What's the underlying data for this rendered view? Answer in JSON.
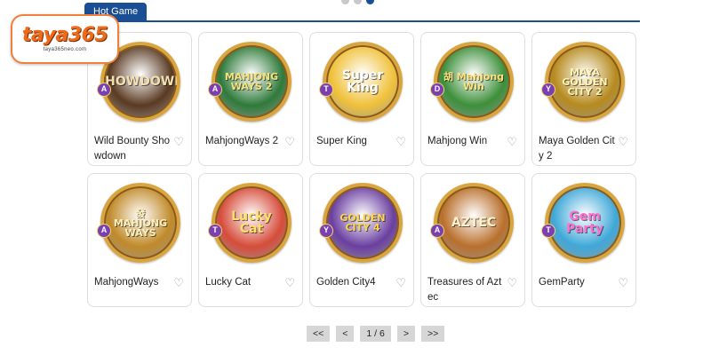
{
  "tabs": {
    "active": "Hot Game"
  },
  "logo": {
    "word": "taya365",
    "sub": "taya365neo.com"
  },
  "games": [
    {
      "name": "Wild Bounty Showdown",
      "art": "SHOWDOWN",
      "badge": "A",
      "bg": "#5a3a22",
      "fg": "#f2dfb0"
    },
    {
      "name": "MahjongWays 2",
      "art": "MAHJONG WAYS 2",
      "badge": "A",
      "bg": "#2f7a3a",
      "fg": "#f6e27a"
    },
    {
      "name": "Super King",
      "art": "Super King",
      "badge": "T",
      "bg": "#f0c13a",
      "fg": "#ffffff"
    },
    {
      "name": "Mahjong Win",
      "art": "胡 Mahjong Win",
      "badge": "D",
      "bg": "#3d8f3a",
      "fg": "#ffe17a"
    },
    {
      "name": "Maya Golden City 2",
      "art": "MAYA GOLDEN CITY 2",
      "badge": "Y",
      "bg": "#b68a1e",
      "fg": "#fff2b0"
    },
    {
      "name": "MahjongWays",
      "art": "發 MAHJONG WAYS",
      "badge": "A",
      "bg": "#c08a2a",
      "fg": "#fff0b8"
    },
    {
      "name": "Lucky Cat",
      "art": "Lucky Cat",
      "badge": "T",
      "bg": "#d64c3a",
      "fg": "#ffe06a"
    },
    {
      "name": "Golden City4",
      "art": "GOLDEN CITY 4",
      "badge": "Y",
      "bg": "#6a3fa0",
      "fg": "#ffd54a"
    },
    {
      "name": "Treasures of Aztec",
      "art": "AZTEC",
      "badge": "A",
      "bg": "#b9702c",
      "fg": "#fff0c8"
    },
    {
      "name": "GemParty",
      "art": "Gem Party",
      "badge": "T",
      "bg": "#3fa8d8",
      "fg": "#ff6fd0"
    }
  ],
  "pagination": {
    "first": "<<",
    "prev": "<",
    "page": "1 / 6",
    "next": ">",
    "last": ">>"
  },
  "icons": {
    "favorite": "heart-outline-icon"
  },
  "colors": {
    "primary": "#1a4f96",
    "logo_orange": "#ef6a1b"
  }
}
